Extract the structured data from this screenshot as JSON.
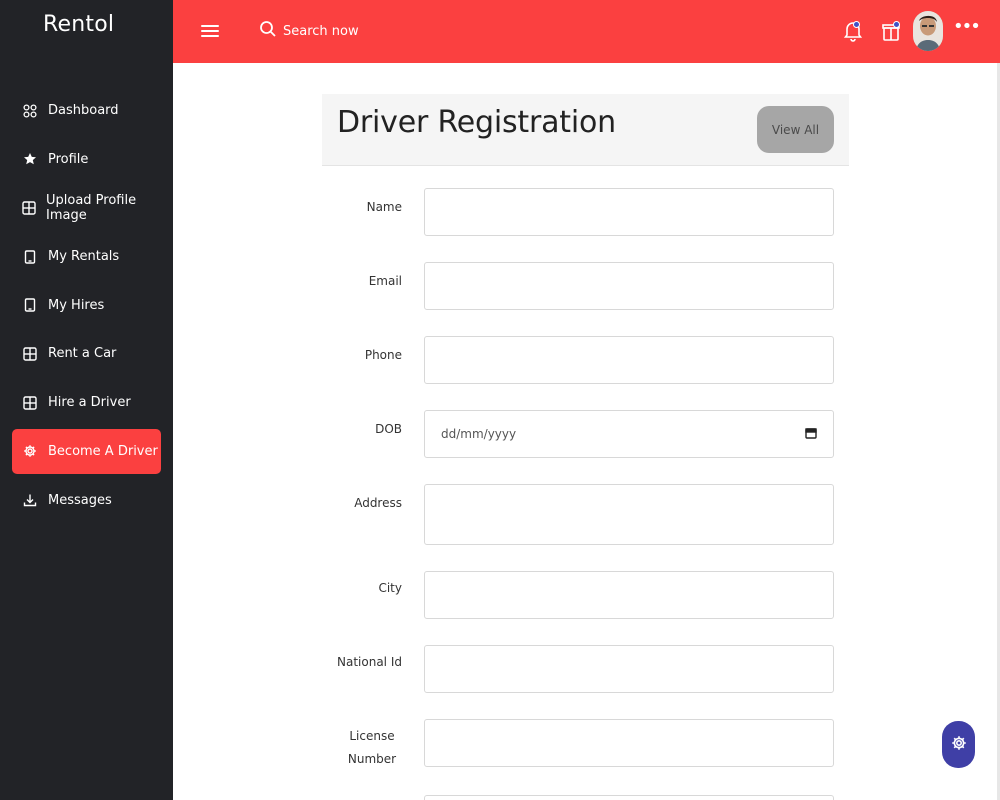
{
  "brand": "Rentol",
  "sidebar": {
    "items": [
      {
        "label": "Dashboard",
        "icon": "grid-circles-icon",
        "active": false
      },
      {
        "label": "Profile",
        "icon": "star-icon",
        "active": false
      },
      {
        "label": "Upload Profile Image",
        "icon": "table-icon",
        "active": false
      },
      {
        "label": "My Rentals",
        "icon": "mobile-icon",
        "active": false
      },
      {
        "label": "My Hires",
        "icon": "mobile-icon",
        "active": false
      },
      {
        "label": "Rent a Car",
        "icon": "table-icon",
        "active": false
      },
      {
        "label": "Hire a Driver",
        "icon": "table-icon",
        "active": false
      },
      {
        "label": "Become A Driver",
        "icon": "gear-icon",
        "active": true
      },
      {
        "label": "Messages",
        "icon": "download-icon",
        "active": false
      }
    ]
  },
  "header": {
    "search_placeholder": "Search now",
    "more_label": "•••"
  },
  "card": {
    "title": "Driver Registration",
    "view_all_label": "View All"
  },
  "form": {
    "name_label": "Name",
    "email_label": "Email",
    "phone_label": "Phone",
    "dob_label": "DOB",
    "dob_placeholder": "dd/mm/yyyy",
    "address_label": "Address",
    "city_label": "City",
    "national_id_label": "National Id",
    "license_label": "License Number"
  },
  "colors": {
    "accent": "#fb4040",
    "sidebar_bg": "#222327",
    "fab_bg": "#3f3fa6",
    "notification_dot": "#3f51c6"
  }
}
